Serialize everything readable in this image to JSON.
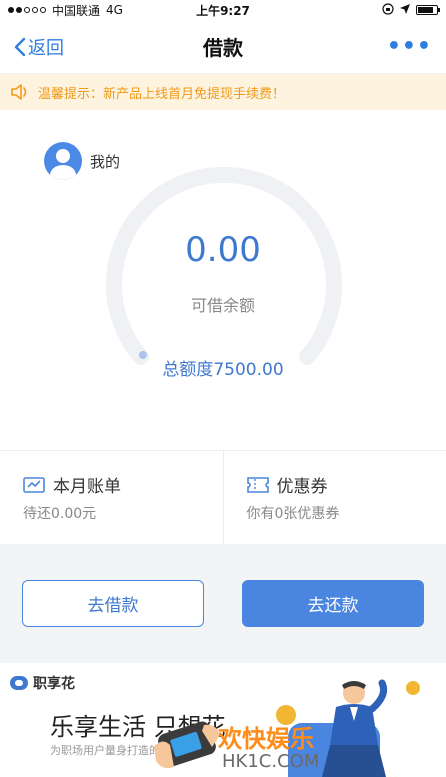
{
  "status_bar": {
    "carrier": "中国联通",
    "network": "4G",
    "time": "上午9:27",
    "signal_bars_filled": 2,
    "signal_bars_total": 5,
    "battery_level": 0.85
  },
  "nav": {
    "back_label": "返回",
    "title": "借款",
    "more_label": "•••"
  },
  "notice": {
    "icon": "speaker-icon",
    "text": "温馨提示：新产品上线首月免提现手续费！",
    "color": "#f19a1b"
  },
  "hero": {
    "mine_label": "我的",
    "amount": "0.00",
    "amount_label": "可借余额",
    "total_label": "总额度7500.00",
    "gauge_fill": 0.0,
    "accent_color": "#3f79cf"
  },
  "cards": [
    {
      "icon": "bill-icon",
      "title": "本月账单",
      "subtitle": "待还0.00元"
    },
    {
      "icon": "coupon-icon",
      "title": "优惠券",
      "subtitle": "你有0张优惠券"
    }
  ],
  "buttons": {
    "borrow": "去借款",
    "repay": "去还款"
  },
  "banner": {
    "brand": "职享花",
    "slogan": "乐享生活 只想花",
    "subtitle": "为职场用户量身打造的消费品牌",
    "watermark_text": "欢快娱乐",
    "watermark_url": "HK1C.COM"
  }
}
